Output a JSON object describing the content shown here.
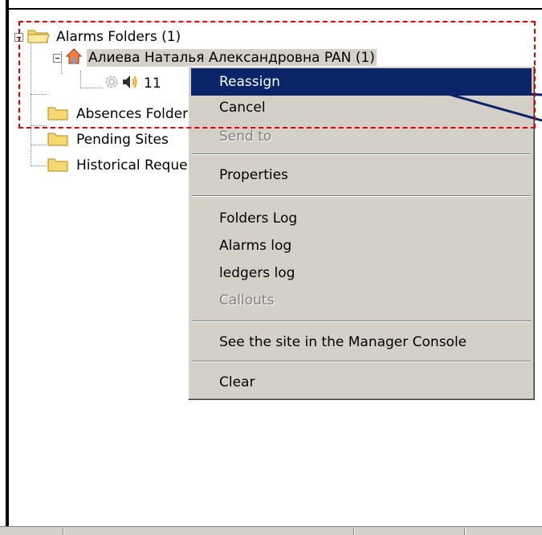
{
  "tree": {
    "alarms_folders": "Alarms Folders (1)",
    "person": "Алиева Наталья Александровна PAN (1)",
    "alarm_item": "11",
    "absences": "Absences Folders",
    "pending_sites": "Pending Sites",
    "historical": "Historical Requests"
  },
  "context_menu": {
    "reassign": "Reassign",
    "cancel": "Cancel",
    "send_to": "Send to",
    "properties": "Properties",
    "folders_log": "Folders Log",
    "alarms_log": "Alarms log",
    "ledgers_log": "ledgers log",
    "callouts": "Callouts",
    "see_site": "See the site in the Manager Console",
    "clear": "Clear"
  },
  "colors": {
    "menu_bg": "#d4d0c8",
    "highlight_bg": "#0a246a",
    "annotation": "#e00000",
    "arrow": "#0a246a"
  },
  "icons": {
    "folder": "folder-icon",
    "house": "house-icon",
    "gear": "gear-icon",
    "speaker": "speaker-icon"
  }
}
